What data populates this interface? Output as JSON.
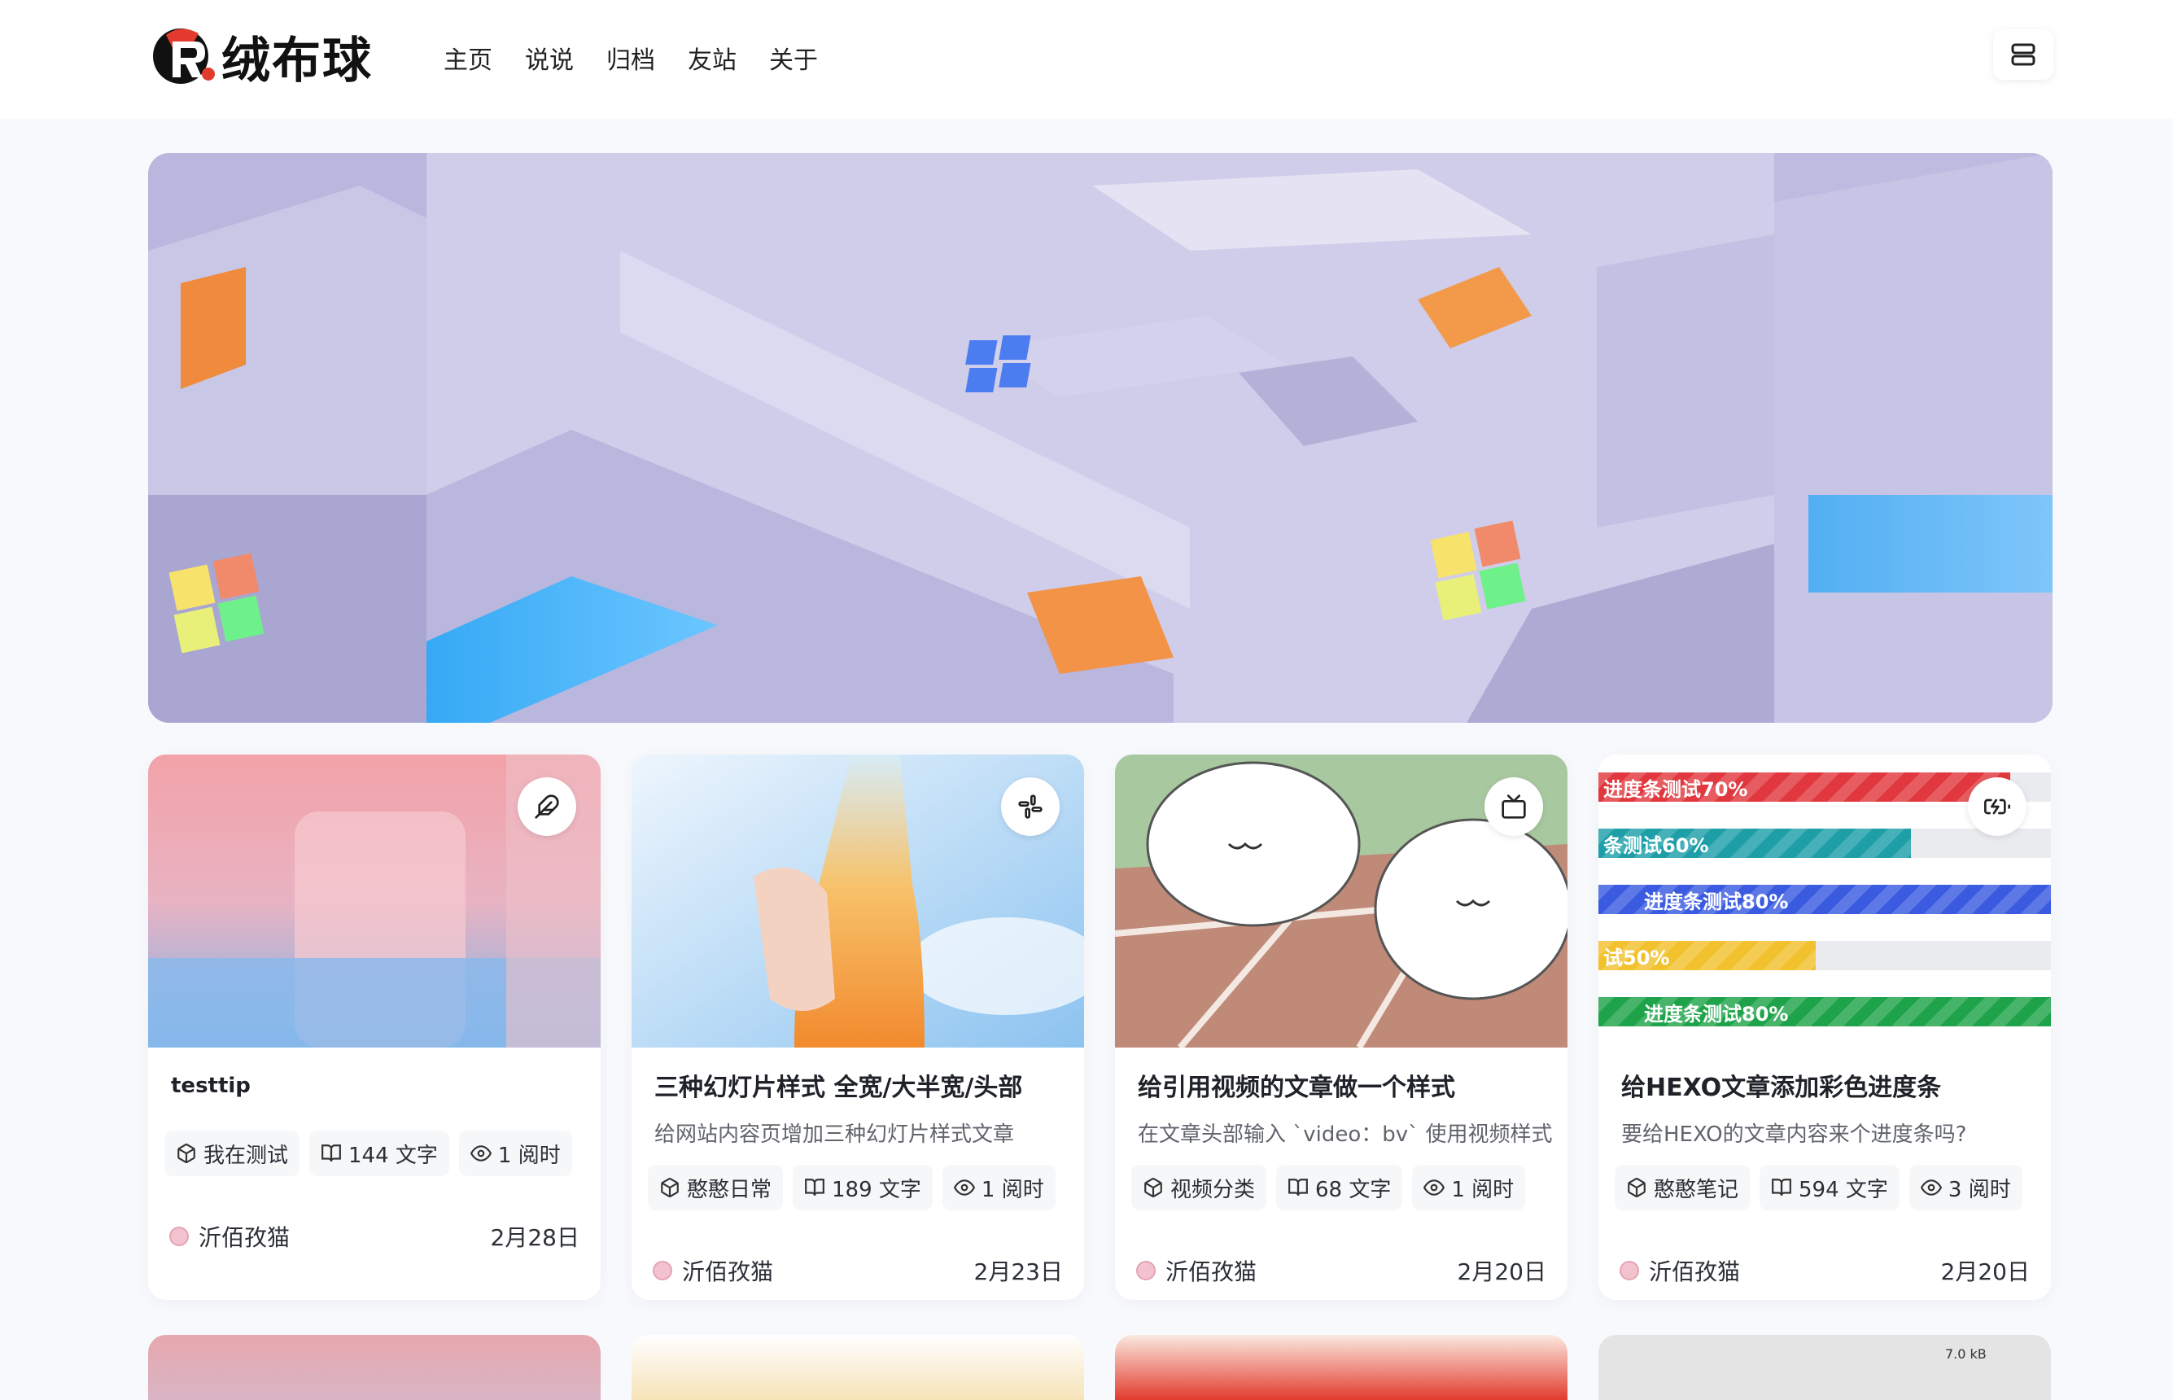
{
  "brand": {
    "logo_text": "绒布球"
  },
  "nav": {
    "items": [
      "主页",
      "说说",
      "归档",
      "友站",
      "关于"
    ]
  },
  "banner": {
    "slide_count": 4,
    "active_index": 3
  },
  "cards": [
    {
      "title": "testtip",
      "description": "",
      "type_icon": "feather-icon",
      "category": "我在测试",
      "words": "144 文字",
      "read_time": "1 阅时",
      "author": "沂佰孜猫",
      "date": "2月28日"
    },
    {
      "title": "三种幻灯片样式 全宽/大半宽/头部",
      "description": "给网站内容页增加三种幻灯片样式文章",
      "type_icon": "slack-icon",
      "category": "憨憨日常",
      "words": "189 文字",
      "read_time": "1 阅时",
      "author": "沂佰孜猫",
      "date": "2月23日"
    },
    {
      "title": "给引用视频的文章做一个样式",
      "description": "在文章头部输入 `video：bv` 使用视频样式",
      "type_icon": "tv-icon",
      "category": "视频分类",
      "words": "68 文字",
      "read_time": "1 阅时",
      "author": "沂佰孜猫",
      "date": "2月20日"
    },
    {
      "title": "给HEXO文章添加彩色进度条",
      "description": "要给HEXO的文章内容来个进度条吗?",
      "type_icon": "battery-charging-icon",
      "category": "憨憨笔记",
      "words": "594 文字",
      "read_time": "3 阅时",
      "author": "沂佰孜猫",
      "date": "2月20日"
    }
  ],
  "progress_bars": [
    {
      "label": "进度条测试70%",
      "percent": 0.91,
      "color": "#e0383e"
    },
    {
      "label": "条测试60%",
      "percent": 0.69,
      "color": "#1e9fa8"
    },
    {
      "label": "进度条测试80%",
      "percent": 1.0,
      "color": "#3a5be0"
    },
    {
      "label": "试50%",
      "percent": 0.48,
      "color": "#f2c12e"
    },
    {
      "label": "进度条测试80%",
      "percent": 1.0,
      "color": "#1fa34a"
    }
  ],
  "row2": {
    "file_size_label": "7.0 kB"
  },
  "colors": {
    "accent": "#111111",
    "page_bg": "#f7f9fc"
  }
}
